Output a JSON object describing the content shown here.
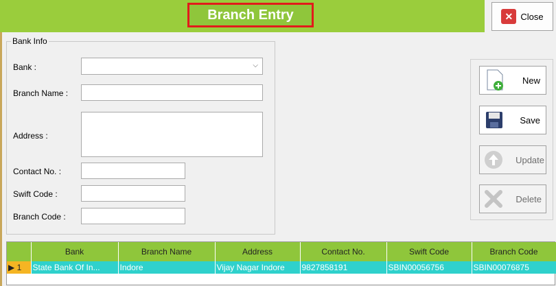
{
  "header": {
    "title": "Branch Entry",
    "close_label": "Close"
  },
  "form": {
    "legend": "Bank Info",
    "bank_label": "Bank :",
    "bank_value": "",
    "branch_name_label": "Branch Name :",
    "branch_name_value": "",
    "address_label": "Address :",
    "address_value": "",
    "contact_label": "Contact No. :",
    "contact_value": "",
    "swift_label": "Swift Code :",
    "swift_value": "",
    "branch_code_label": "Branch Code :",
    "branch_code_value": ""
  },
  "actions": {
    "new": "New",
    "save": "Save",
    "update": "Update",
    "delete": "Delete"
  },
  "grid": {
    "columns": [
      "",
      "Bank",
      "Branch Name",
      "Address",
      "Contact No.",
      "Swift Code",
      "Branch Code"
    ],
    "rows": [
      [
        "1",
        "State Bank Of In...",
        "Indore",
        "Vijay Nagar Indore",
        "9827858191",
        "SBIN00056756",
        "SBIN00076875"
      ]
    ]
  },
  "colors": {
    "header_green": "#9acd3c",
    "grid_header": "#8fc63b",
    "grid_row": "#2fd1cc",
    "title_border": "#e21b1b"
  }
}
